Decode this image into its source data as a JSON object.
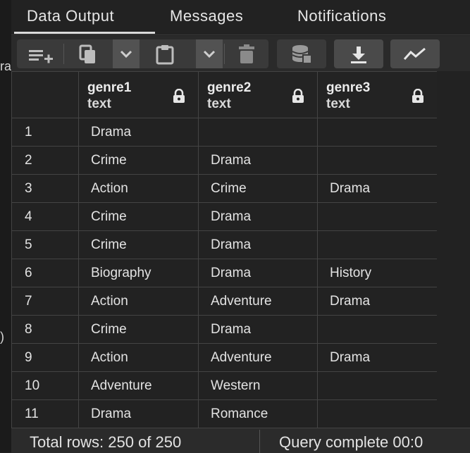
{
  "tabs": [
    {
      "label": "Data Output",
      "active": true
    },
    {
      "label": "Messages",
      "active": false
    },
    {
      "label": "Notifications",
      "active": false
    }
  ],
  "left_gutter": {
    "fragment_top": "ra",
    "fragment_bottom": ")"
  },
  "toolbar": {
    "icons": [
      "add-row-icon",
      "copy-icon",
      "chevron-down-icon",
      "paste-icon",
      "chevron-down-icon",
      "delete-icon",
      "save-data-icon",
      "download-icon",
      "graph-icon"
    ]
  },
  "columns": [
    {
      "name": "",
      "type": ""
    },
    {
      "name": "genre1",
      "type": "text",
      "locked": true
    },
    {
      "name": "genre2",
      "type": "text",
      "locked": true
    },
    {
      "name": "genre3",
      "type": "text",
      "locked": true
    }
  ],
  "rows": [
    [
      "1",
      "Drama",
      "",
      ""
    ],
    [
      "2",
      "Crime",
      "Drama",
      ""
    ],
    [
      "3",
      "Action",
      "Crime",
      "Drama"
    ],
    [
      "4",
      "Crime",
      "Drama",
      ""
    ],
    [
      "5",
      "Crime",
      "Drama",
      ""
    ],
    [
      "6",
      "Biography",
      "Drama",
      "History"
    ],
    [
      "7",
      "Action",
      "Adventure",
      "Drama"
    ],
    [
      "8",
      "Crime",
      "Drama",
      ""
    ],
    [
      "9",
      "Action",
      "Adventure",
      "Drama"
    ],
    [
      "10",
      "Adventure",
      "Western",
      ""
    ],
    [
      "11",
      "Drama",
      "Romance",
      ""
    ]
  ],
  "status": {
    "rows_text": "Total rows: 250 of 250",
    "query_text": "Query complete 00:0"
  },
  "colors": {
    "background": "#222222",
    "toolbar": "#2a2a2a",
    "grid_border": "#444444",
    "text": "#e3e3e3"
  }
}
